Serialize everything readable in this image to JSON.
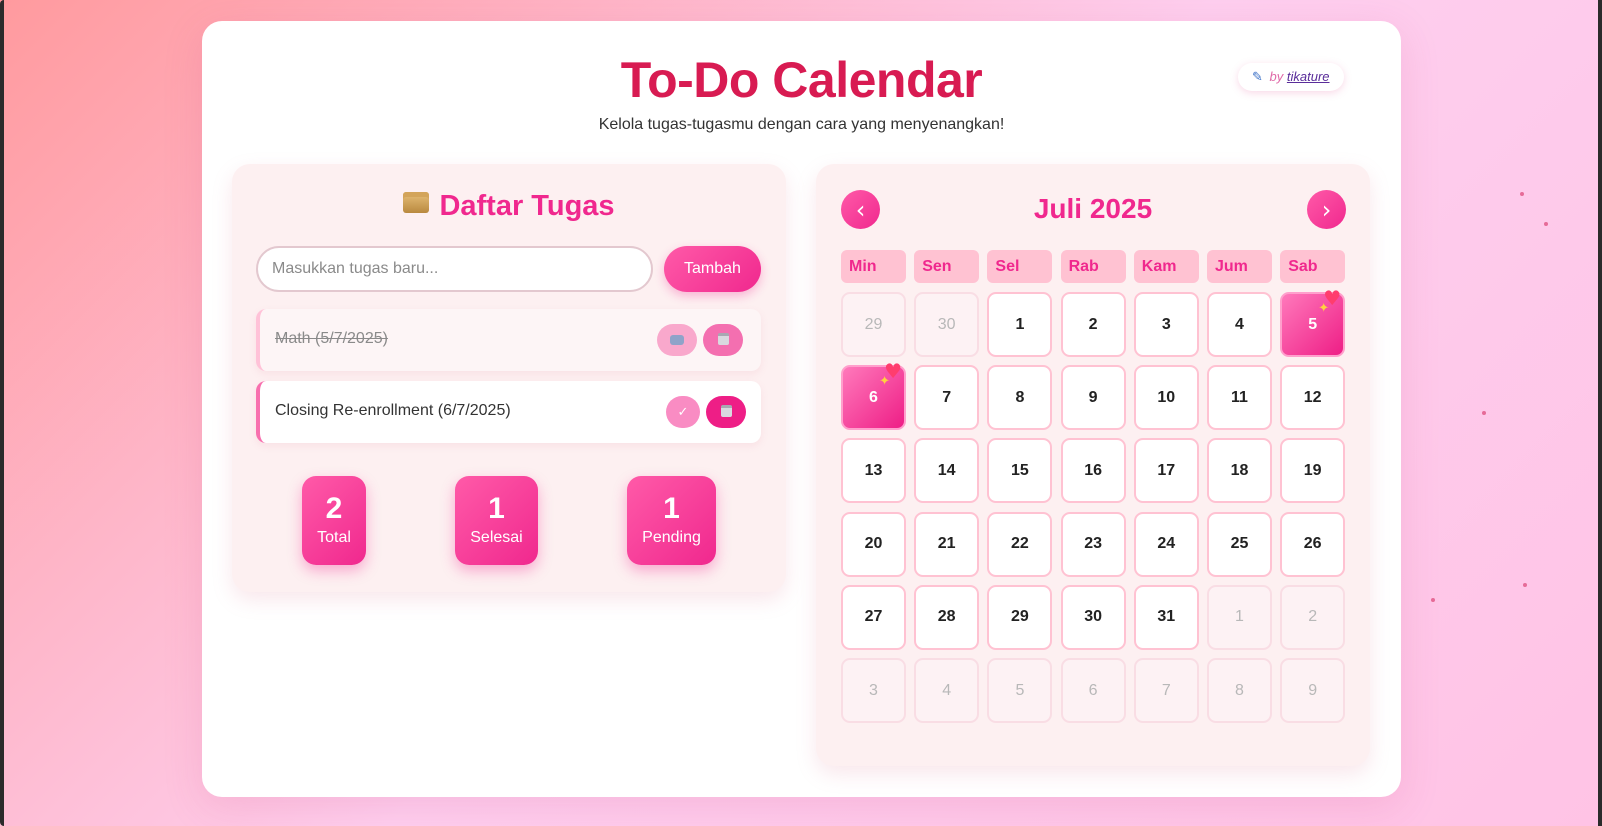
{
  "header": {
    "title": "To-Do Calendar",
    "subtitle": "Kelola tugas-tugasmu dengan cara yang menyenangkan!",
    "byline_prefix": "by",
    "byline_author": "tikature"
  },
  "tasks_panel": {
    "title": "Daftar Tugas",
    "input_placeholder": "Masukkan tugas baru...",
    "add_button": "Tambah",
    "tasks": [
      {
        "text": "Math (5/7/2025)",
        "status": "done"
      },
      {
        "text": "Closing Re-enrollment (6/7/2025)",
        "status": "pending"
      }
    ],
    "stats": [
      {
        "value": "2",
        "label": "Total"
      },
      {
        "value": "1",
        "label": "Selesai"
      },
      {
        "value": "1",
        "label": "Pending"
      }
    ],
    "check_symbol": "✓"
  },
  "calendar": {
    "month_title": "Juli 2025",
    "prev_symbol": "‹",
    "next_symbol": "›",
    "weekdays": [
      "Min",
      "Sen",
      "Sel",
      "Rab",
      "Kam",
      "Jum",
      "Sab"
    ],
    "days": [
      {
        "label": "29",
        "state": "other"
      },
      {
        "label": "30",
        "state": "other"
      },
      {
        "label": "1",
        "state": "current"
      },
      {
        "label": "2",
        "state": "current"
      },
      {
        "label": "3",
        "state": "current"
      },
      {
        "label": "4",
        "state": "current"
      },
      {
        "label": "5",
        "state": "highlight"
      },
      {
        "label": "6",
        "state": "highlight"
      },
      {
        "label": "7",
        "state": "current"
      },
      {
        "label": "8",
        "state": "current"
      },
      {
        "label": "9",
        "state": "current"
      },
      {
        "label": "10",
        "state": "current"
      },
      {
        "label": "11",
        "state": "current"
      },
      {
        "label": "12",
        "state": "current"
      },
      {
        "label": "13",
        "state": "current"
      },
      {
        "label": "14",
        "state": "current"
      },
      {
        "label": "15",
        "state": "current"
      },
      {
        "label": "16",
        "state": "current"
      },
      {
        "label": "17",
        "state": "current"
      },
      {
        "label": "18",
        "state": "current"
      },
      {
        "label": "19",
        "state": "current"
      },
      {
        "label": "20",
        "state": "current"
      },
      {
        "label": "21",
        "state": "current"
      },
      {
        "label": "22",
        "state": "current"
      },
      {
        "label": "23",
        "state": "current"
      },
      {
        "label": "24",
        "state": "current"
      },
      {
        "label": "25",
        "state": "current"
      },
      {
        "label": "26",
        "state": "current"
      },
      {
        "label": "27",
        "state": "current"
      },
      {
        "label": "28",
        "state": "current"
      },
      {
        "label": "29",
        "state": "current"
      },
      {
        "label": "30",
        "state": "current"
      },
      {
        "label": "31",
        "state": "current"
      },
      {
        "label": "1",
        "state": "other"
      },
      {
        "label": "2",
        "state": "other"
      },
      {
        "label": "3",
        "state": "other"
      },
      {
        "label": "4",
        "state": "other"
      },
      {
        "label": "5",
        "state": "other"
      },
      {
        "label": "6",
        "state": "other"
      },
      {
        "label": "7",
        "state": "other"
      },
      {
        "label": "8",
        "state": "other"
      },
      {
        "label": "9",
        "state": "other"
      }
    ]
  },
  "icons": {
    "byline": "pen-icon",
    "panel_title": "folder-icon",
    "highlight_day": "heart-sparkle-icon",
    "undo": "undo-icon",
    "delete": "trash-icon",
    "complete": "check-icon"
  },
  "colors": {
    "accent": "#f0288e",
    "title": "#d81b52",
    "panel_bg": "#fdf0f1",
    "highlight_day": "#ee1e86"
  }
}
